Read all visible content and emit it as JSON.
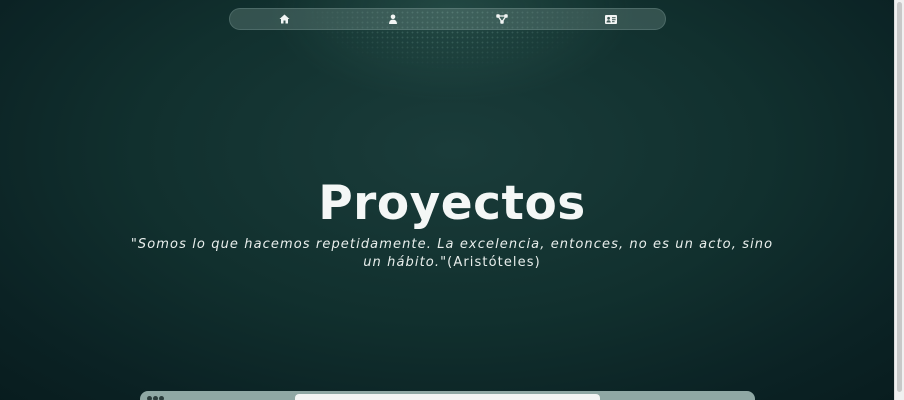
{
  "nav": {
    "items": [
      {
        "name": "home",
        "icon": "home-icon"
      },
      {
        "name": "about",
        "icon": "user-icon"
      },
      {
        "name": "projects",
        "icon": "network-icon"
      },
      {
        "name": "contact",
        "icon": "id-card-icon"
      }
    ]
  },
  "hero": {
    "title": "Proyectos",
    "quote": "\"Somos lo que hacemos repetidamente. La excelencia, entonces, no es un acto, sino un hábito.\"",
    "author": "(Aristóteles)"
  },
  "colors": {
    "background_dark": "#0b2224",
    "background_mid": "#1a3c3a",
    "text": "#f4f7f6",
    "nav_bg": "#6e8c87",
    "bottom_bar": "#8fa8a4"
  }
}
